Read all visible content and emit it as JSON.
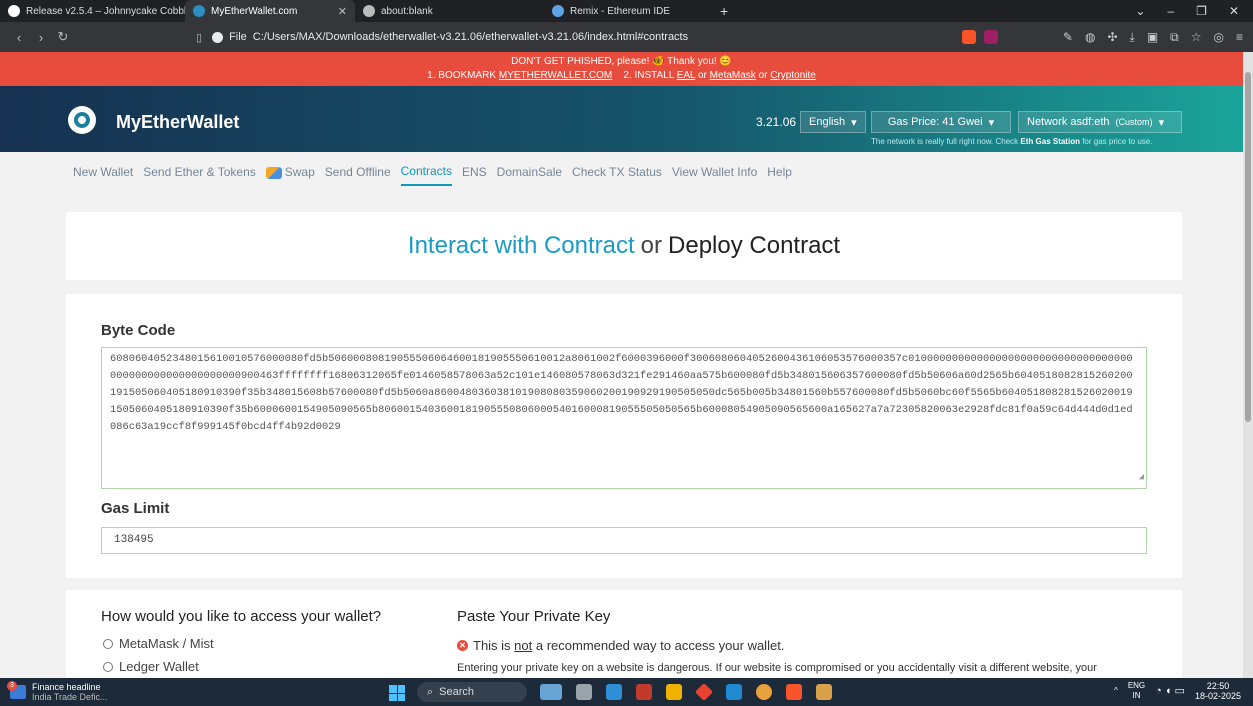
{
  "browser": {
    "tabs": [
      {
        "label": "Release v2.5.4 – Johnnycake Cobble",
        "active": false,
        "fav_color": "#ffffff"
      },
      {
        "label": "MyEtherWallet.com",
        "active": true,
        "fav_color": "#2b8fc3"
      },
      {
        "label": "about:blank",
        "active": false,
        "fav_color": "#bbbbbb"
      },
      {
        "label": "Remix - Ethereum IDE",
        "active": false,
        "fav_color": "#5ea3e6"
      }
    ],
    "new_tab": "+",
    "file_label": "File",
    "url": "C:/Users/MAX/Downloads/etherwallet-v3.21.06/etherwallet-v3.21.06/index.html#contracts"
  },
  "banner": {
    "line1": "DON'T GET PHISHED, please! 🐠 Thank you! 😊",
    "prefix": "1. BOOKMARK ",
    "bookmark_link": "MYETHERWALLET.COM",
    "install_text": "2. INSTALL ",
    "eal": "EAL",
    "or1": " or ",
    "metamask": "MetaMask",
    "or2": " or ",
    "cryptonite": "Cryptonite"
  },
  "header": {
    "brand": "MyEtherWallet",
    "version": "3.21.06",
    "language": "English",
    "gas_price": "Gas Price: 41 Gwei",
    "network": "Network asdf:eth",
    "network_suffix": "(Custom)",
    "gas_note_pre": "The network is really full right now. Check ",
    "gas_note_link": "Eth Gas Station",
    "gas_note_post": " for gas price to use."
  },
  "nav": {
    "new_wallet": "New Wallet",
    "send": "Send Ether & Tokens",
    "swap": "Swap",
    "offline": "Send Offline",
    "contracts": "Contracts",
    "ens": "ENS",
    "domainsale": "DomainSale",
    "check_tx": "Check TX Status",
    "view_wallet": "View Wallet Info",
    "help": "Help"
  },
  "title": {
    "interact": "Interact with Contract",
    "or": "or",
    "deploy": "Deploy Contract"
  },
  "deploy": {
    "bytecode_label": "Byte Code",
    "bytecode": "6080604052348015610010576000080fd5b50600080819055506064600181905550610012a8061002f6000396000f3006080604052600436106053576000357c010000000000000000000000000000000000000000000000000000000900463ffffffff16806312065fe0146058578063a52c101e146080578063d321fe291460aa575b600080fd5b348015606357600080fd5b50606a60d2565b6040518082815260200191505060405180910390f35b348015608b57600080fd5b5060a860048036038101908080359060200190929190505050dc565b005b34801560b557600080fd5b5060bc60f5565b6040518082815260200191505060405180910390f35b6000600154905090565b806001540360018190555080600054016000819055505050565b60008054905090565600a165627a7a72305820063e2928fdc81f0a59c64d444d0d1ed086c63a19ccf8f999145f0bcd4ff4b92d0029",
    "gas_label": "Gas Limit",
    "gas_value": "138495"
  },
  "access": {
    "question": "How would you like to access your wallet?",
    "options": [
      "MetaMask / Mist",
      "Ledger Wallet"
    ],
    "pk_title": "Paste Your Private Key",
    "warn_pre": "This is ",
    "warn_not": "not",
    "warn_post": " a recommended way to access your wallet.",
    "desc": "Entering your private key on a website is dangerous. If our website is compromised or you accidentally visit a different website, your"
  },
  "taskbar": {
    "news_badge": "3",
    "news_title": "Finance headline",
    "news_sub": "India Trade Defic...",
    "search": "Search",
    "lang": "ENG",
    "region": "IN",
    "time": "22:50",
    "date": "18-02-2025"
  }
}
